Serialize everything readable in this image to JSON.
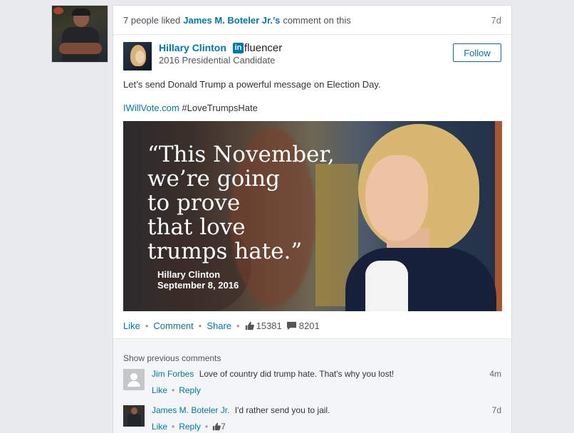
{
  "activity": {
    "prefix": "7 people liked",
    "actor": "James M. Boteler Jr.’s",
    "suffix": "comment on this",
    "time": "7d"
  },
  "post": {
    "author_name": "Hillary Clinton",
    "badge_in": "in",
    "badge_rest": "fluencer",
    "author_title": "2016 Presidential Candidate",
    "follow_label": "Follow",
    "text": "Let’s send Donald Trump a powerful message on Election Day.",
    "link_url": "IWillVote.com",
    "hashtag": "#LoveTrumpsHate",
    "image": {
      "quote": "“This November,\n  we’re going\n  to prove\n  that love\n  trumps hate.”",
      "quote_author": "Hillary Clinton",
      "quote_date": "September 8, 2016"
    }
  },
  "actions": {
    "like": "Like",
    "comment": "Comment",
    "share": "Share",
    "likes_count": "15381",
    "comments_count": "8201"
  },
  "comments": {
    "show_previous": "Show previous comments",
    "items": [
      {
        "name": "Jim Forbes",
        "text": "Love of country did trump hate. That's why you lost!",
        "time": "4m",
        "like": "Like",
        "reply": "Reply",
        "likes": ""
      },
      {
        "name": "James M. Boteler Jr.",
        "text": "I'd rather send you to jail.",
        "time": "7d",
        "like": "Like",
        "reply": "Reply",
        "likes": "7"
      }
    ]
  },
  "colors": {
    "link": "#0077b5",
    "background": "#e9eaee",
    "comments_bg": "#f4f5f7"
  }
}
